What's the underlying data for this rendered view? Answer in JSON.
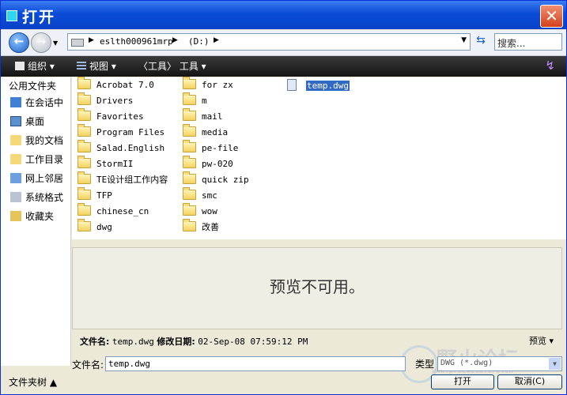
{
  "window": {
    "title": "打开",
    "close_glyph": "✕"
  },
  "address": {
    "breadcrumbs": [
      "eslth000961mrp",
      "(D:)"
    ],
    "search_placeholder": "搜索..."
  },
  "toolbar": {
    "organize": "组织",
    "view": "视图",
    "tools": "〈工具〉 工具"
  },
  "sidebar": {
    "header": "公用文件夹",
    "items": [
      "在会话中",
      "桌面",
      "我的文档",
      "工作目录",
      "网上邻居",
      "系统格式",
      "收藏夹"
    ]
  },
  "files": {
    "col1": [
      "Acrobat 7.0",
      "Drivers",
      "Favorites",
      "Program Files",
      "Salad.English",
      "StormII",
      "TE设计组工作内容",
      "TFP",
      "chinese_cn",
      "dwg"
    ],
    "col2": [
      "for zx",
      "m",
      "mail",
      "media",
      "pe-file",
      "pw-020",
      "quick zip",
      "smc",
      "wow",
      "改善"
    ],
    "col3": [
      "temp.dwg"
    ]
  },
  "preview": {
    "text": "预览不可用。",
    "toggle": "预览 ▾"
  },
  "details": {
    "name_label": "文件名:",
    "name_value": "temp.dwg",
    "modified_label": "修改日期:",
    "modified_value": "02-Sep-08 07:59:12 PM"
  },
  "footer": {
    "filename_label": "文件名:",
    "filename_value": "temp.dwg",
    "type_label": "类型",
    "type_value": "DWG (*.dwg)",
    "tree_toggle": "文件夹树 ▲",
    "open": "打开",
    "cancel": "取消(C)"
  },
  "watermark": {
    "text": "野火论坛",
    "sub": "www.proewildfire.cn"
  }
}
